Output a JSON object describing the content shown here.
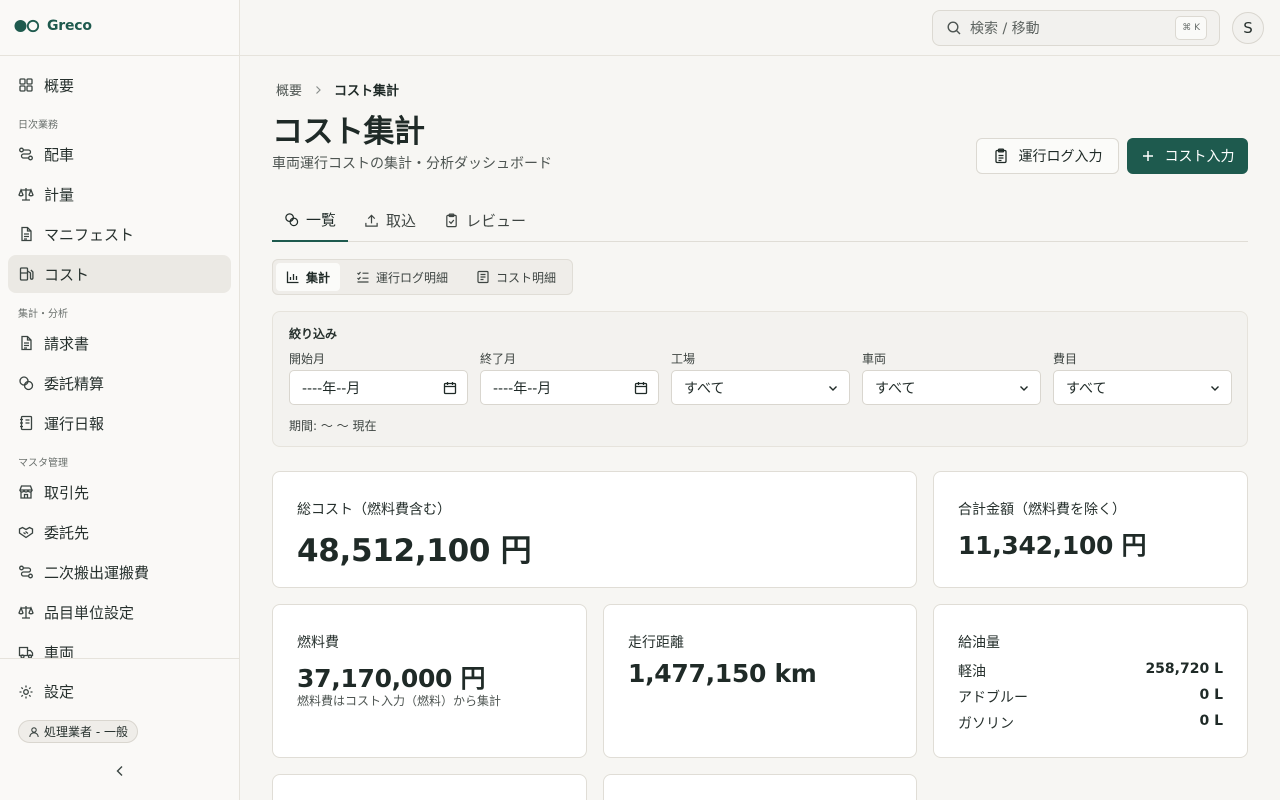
{
  "app": {
    "name": "Greco"
  },
  "sidebar": {
    "items": [
      {
        "label": "概要",
        "icon": "grid-icon"
      },
      {
        "group": "日次業務"
      },
      {
        "label": "配車",
        "icon": "route-icon"
      },
      {
        "label": "計量",
        "icon": "scale-icon"
      },
      {
        "label": "マニフェスト",
        "icon": "document-icon"
      },
      {
        "label": "コスト",
        "icon": "fuel-icon",
        "active": true
      },
      {
        "group": "集計・分析"
      },
      {
        "label": "請求書",
        "icon": "document-icon"
      },
      {
        "label": "委託精算",
        "icon": "coins-icon"
      },
      {
        "label": "運行日報",
        "icon": "notebook-icon"
      },
      {
        "group": "マスタ管理"
      },
      {
        "label": "取引先",
        "icon": "store-icon"
      },
      {
        "label": "委託先",
        "icon": "handshake-icon"
      },
      {
        "label": "二次搬出運搬費",
        "icon": "route-icon"
      },
      {
        "label": "品目単位設定",
        "icon": "scale-icon"
      },
      {
        "label": "車両",
        "icon": "truck-icon"
      }
    ],
    "settings_label": "設定",
    "role_badge": "処理業者 - 一般"
  },
  "topbar": {
    "search_placeholder": "検索 / 移動",
    "shortcut": "⌘ K",
    "avatar_initial": "S"
  },
  "breadcrumb": {
    "parent": "概要",
    "current": "コスト集計"
  },
  "header": {
    "title": "コスト集計",
    "subtitle": "車両運行コストの集計・分析ダッシュボード",
    "log_button": "運行ログ入力",
    "cost_button": "コスト入力"
  },
  "tabs": [
    {
      "label": "一覧",
      "active": true
    },
    {
      "label": "取込"
    },
    {
      "label": "レビュー"
    }
  ],
  "subtabs": [
    {
      "label": "集計",
      "active": true
    },
    {
      "label": "運行ログ明細"
    },
    {
      "label": "コスト明細"
    }
  ],
  "filters": {
    "title": "絞り込み",
    "start_month": {
      "label": "開始月",
      "value": "----年--月"
    },
    "end_month": {
      "label": "終了月",
      "value": "----年--月"
    },
    "plant": {
      "label": "工場",
      "value": "すべて"
    },
    "vehicle": {
      "label": "車両",
      "value": "すべて"
    },
    "expense": {
      "label": "費目",
      "value": "すべて"
    },
    "period": "期間: 〜 〜 現在"
  },
  "stats": {
    "total_cost": {
      "label": "総コスト（燃料費含む）",
      "value": "48,512,100 円"
    },
    "total_ex_fuel": {
      "label": "合計金額（燃料費を除く）",
      "value": "11,342,100 円"
    },
    "fuel_cost": {
      "label": "燃料費",
      "value": "37,170,000 円",
      "note": "燃料費はコスト入力（燃料）から集計"
    },
    "distance": {
      "label": "走行距離",
      "value": "1,477,150 km"
    },
    "fuel_volume": {
      "label": "給油量",
      "rows": [
        {
          "name": "軽油",
          "value": "258,720 L"
        },
        {
          "name": "アドブルー",
          "value": "0 L"
        },
        {
          "name": "ガソリン",
          "value": "0 L"
        }
      ]
    }
  },
  "colors": {
    "primary": "#1e5a4e",
    "background": "#f7f6f3",
    "card": "#ffffff"
  }
}
